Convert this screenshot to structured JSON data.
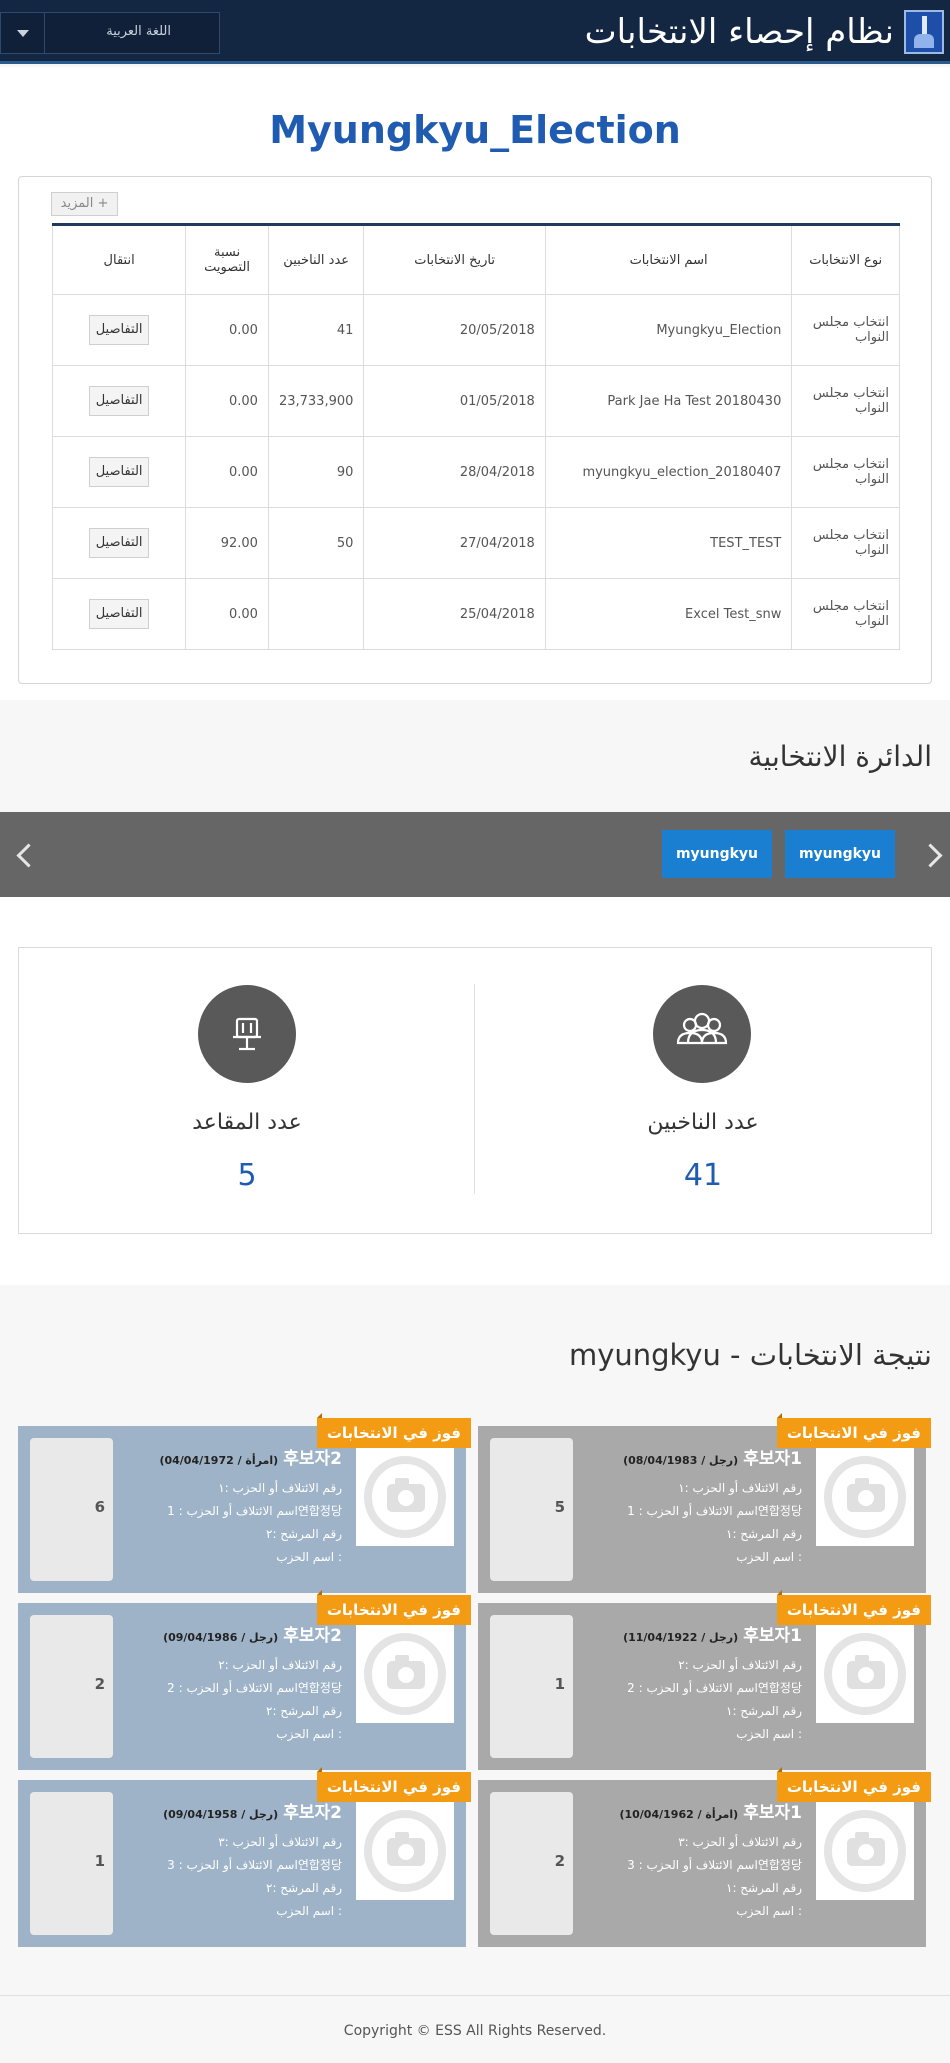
{
  "header": {
    "app_title": "نظام إحصاء الانتخابات",
    "language_select": "اللغة العربية"
  },
  "election": {
    "title": "Myungkyu_Election",
    "more_button": "المزيد +",
    "columns": [
      "نوع الانتخابات",
      "اسم الانتخابات",
      "تاريخ الانتخابات",
      "عدد الناخبين",
      "نسبة التصويت",
      "انتقال"
    ],
    "rows": [
      {
        "type": "انتخاب مجلس النواب",
        "name": "Myungkyu_Election",
        "date": "20/05/2018",
        "voters": "41",
        "rate": "0.00",
        "action": "التفاصيل"
      },
      {
        "type": "انتخاب مجلس النواب",
        "name": "Park Jae Ha Test 20180430",
        "date": "01/05/2018",
        "voters": "23,733,900",
        "rate": "0.00",
        "action": "التفاصيل"
      },
      {
        "type": "انتخاب مجلس النواب",
        "name": "myungkyu_election_20180407",
        "date": "28/04/2018",
        "voters": "90",
        "rate": "0.00",
        "action": "التفاصيل"
      },
      {
        "type": "انتخاب مجلس النواب",
        "name": "TEST_TEST",
        "date": "27/04/2018",
        "voters": "50",
        "rate": "92.00",
        "action": "التفاصيل"
      },
      {
        "type": "انتخاب مجلس النواب",
        "name": "Excel Test_snw",
        "date": "25/04/2018",
        "voters": "",
        "rate": "0.00",
        "action": "التفاصيل"
      }
    ]
  },
  "district": {
    "heading": "الدائرة الانتخابية",
    "buttons": [
      "myungkyu",
      "myungkyu"
    ]
  },
  "stats": {
    "voters_label": "عدد الناخبين",
    "voters_value": "41",
    "seats_label": "عدد المقاعد",
    "seats_value": "5"
  },
  "results": {
    "heading": "myungkyu - نتيجة الانتخابات",
    "badge": "فوز في الانتخابات",
    "cards": [
      {
        "name": "후보자1",
        "meta": "(رجل / 08/04/1983)",
        "line1": "رقم الائتلاف أو الحزب :١",
        "line2": "اسم الائتلاف أو الحزب : 1연합정당",
        "line3": "رقم المرشح :١",
        "line4": "اسم الحزب :",
        "votes": "5",
        "theme": "gray"
      },
      {
        "name": "후보자2",
        "meta": "(امرأة / 04/04/1972)",
        "line1": "رقم الائتلاف أو الحزب :١",
        "line2": "اسم الائتلاف أو الحزب : 1연합정당",
        "line3": "رقم المرشح :٢",
        "line4": "اسم الحزب :",
        "votes": "6",
        "theme": "blue"
      },
      {
        "name": "후보자1",
        "meta": "(رجل / 11/04/1922)",
        "line1": "رقم الائتلاف أو الحزب :٢",
        "line2": "اسم الائتلاف أو الحزب : 2연합정당",
        "line3": "رقم المرشح :١",
        "line4": "اسم الحزب :",
        "votes": "1",
        "theme": "gray"
      },
      {
        "name": "후보자2",
        "meta": "(رجل / 09/04/1986)",
        "line1": "رقم الائتلاف أو الحزب :٢",
        "line2": "اسم الائتلاف أو الحزب : 2연합정당",
        "line3": "رقم المرشح :٢",
        "line4": "اسم الحزب :",
        "votes": "2",
        "theme": "blue"
      },
      {
        "name": "후보자1",
        "meta": "(امرأة / 10/04/1962)",
        "line1": "رقم الائتلاف أو الحزب :٣",
        "line2": "اسم الائتلاف أو الحزب : 3연합정당",
        "line3": "رقم المرشح :١",
        "line4": "اسم الحزب :",
        "votes": "2",
        "theme": "gray"
      },
      {
        "name": "후보자2",
        "meta": "(رجل / 09/04/1958)",
        "line1": "رقم الائتلاف أو الحزب :٣",
        "line2": "اسم الائتلاف أو الحزب : 3연합정당",
        "line3": "رقم المرشح :٢",
        "line4": "اسم الحزب :",
        "votes": "1",
        "theme": "blue"
      }
    ]
  },
  "footer": {
    "copyright": "Copyright © ESS All Rights Reserved."
  },
  "colors": {
    "header_bg": "#132743",
    "accent_blue": "#1f5bb0",
    "district_button": "#1a7fd1",
    "badge_orange": "#f39b13"
  }
}
